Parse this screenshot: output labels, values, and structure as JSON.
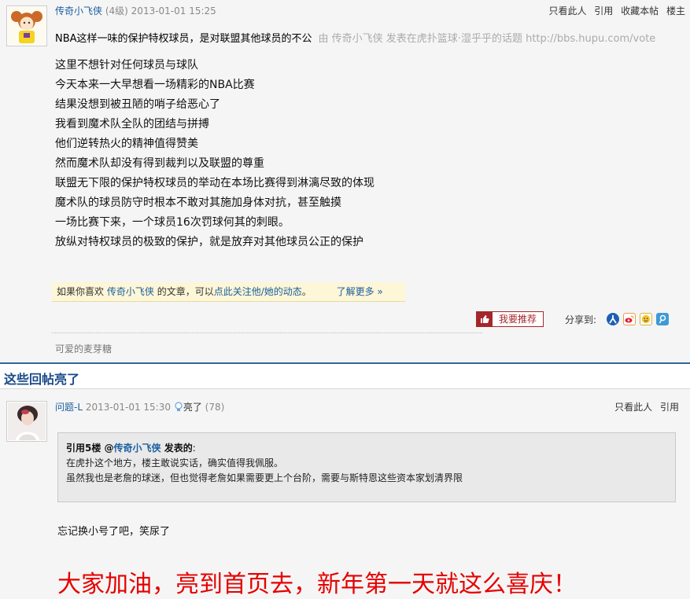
{
  "post1": {
    "username": "传奇小飞侠",
    "level": "(4级)",
    "datetime": "2013-01-01 15:25",
    "actions": [
      "只看此人",
      "引用",
      "收藏本帖",
      "楼主"
    ],
    "title": "NBA这样一味的保护特权球员，是对联盟其他球员的不公",
    "source": "由 传奇小飞侠 发表在虎扑篮球·湿乎乎的话题 http://bbs.hupu.com/vote",
    "body": [
      "这里不想针对任何球员与球队",
      "今天本来一大早想看一场精彩的NBA比赛",
      "结果没想到被丑陋的哨子给恶心了",
      "我看到魔术队全队的团结与拼搏",
      "他们逆转热火的精神值得赞美",
      "然而魔术队却没有得到裁判以及联盟的尊重",
      "联盟无下限的保护特权球员的举动在本场比赛得到淋漓尽致的体现",
      "魔术队的球员防守时根本不敢对其施加身体对抗，甚至触摸",
      "一场比赛下来，一个球员16次罚球何其的刺眼。",
      "放纵对特权球员的极致的保护，就是放弃对其他球员公正的保护"
    ],
    "follow_prefix": "如果你喜欢",
    "follow_user": "传奇小飞侠",
    "follow_mid": "的文章，可以",
    "follow_link": "点此关注他/她的动态",
    "follow_suffix": "。",
    "learn_more": "了解更多 »",
    "recommend": "我要推荐",
    "share_label": "分享到:",
    "signature": "可爱的麦芽糖"
  },
  "section_title": "这些回帖亮了",
  "post2": {
    "username": "问题-L",
    "datetime": "2013-01-01 15:30",
    "light_label": "亮了",
    "light_count": "(78)",
    "actions": [
      "只看此人",
      "引用"
    ],
    "quote_prefix": "引用5楼 @",
    "quote_user": "传奇小飞侠",
    "quote_suffix": " 发表的",
    "quote_colon": ":",
    "quote_lines": [
      "在虎扑这个地方，楼主敢说实话，确实值得我佩服。",
      "虽然我也是老詹的球迷，但也觉得老詹如果需要更上个台阶，需要与斯特恩这些资本家划清界限"
    ],
    "reply": "忘记换小号了吧，笑尿了",
    "big_text": "大家加油，亮到首页去，新年第一天就这么喜庆！"
  },
  "icons": [
    "renren-icon",
    "weibo-icon",
    "qzone-icon",
    "tencent-weibo-icon"
  ],
  "colors": {
    "link": "#1a5e9e",
    "accent_red": "#e60000",
    "section_blue": "#336699",
    "rec_red": "#a4272b"
  }
}
